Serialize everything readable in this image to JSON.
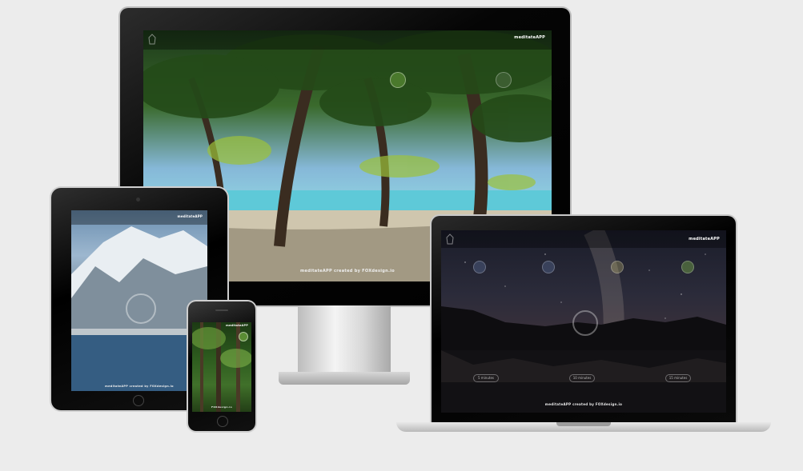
{
  "monitor": {
    "brand": "meditateAPP",
    "footer": "meditateAPP created by FOXdesign.io"
  },
  "tablet": {
    "brand": "meditateAPP",
    "footer": "meditateAPP created by FOXdesign.io"
  },
  "phone": {
    "brand": "meditateAPP",
    "footer": "FOXdesign.io"
  },
  "laptop": {
    "brand": "meditateAPP",
    "footer": "meditateAPP created by FOXdesign.io",
    "pill_left": "5 minutes",
    "pill_mid": "10 minutes",
    "pill_right": "15 minutes"
  },
  "colors": {
    "background": "#ececec",
    "accent_green": "#8fd14f"
  },
  "icons": [
    "logo-icon",
    "pause-icon",
    "sound-icon"
  ]
}
